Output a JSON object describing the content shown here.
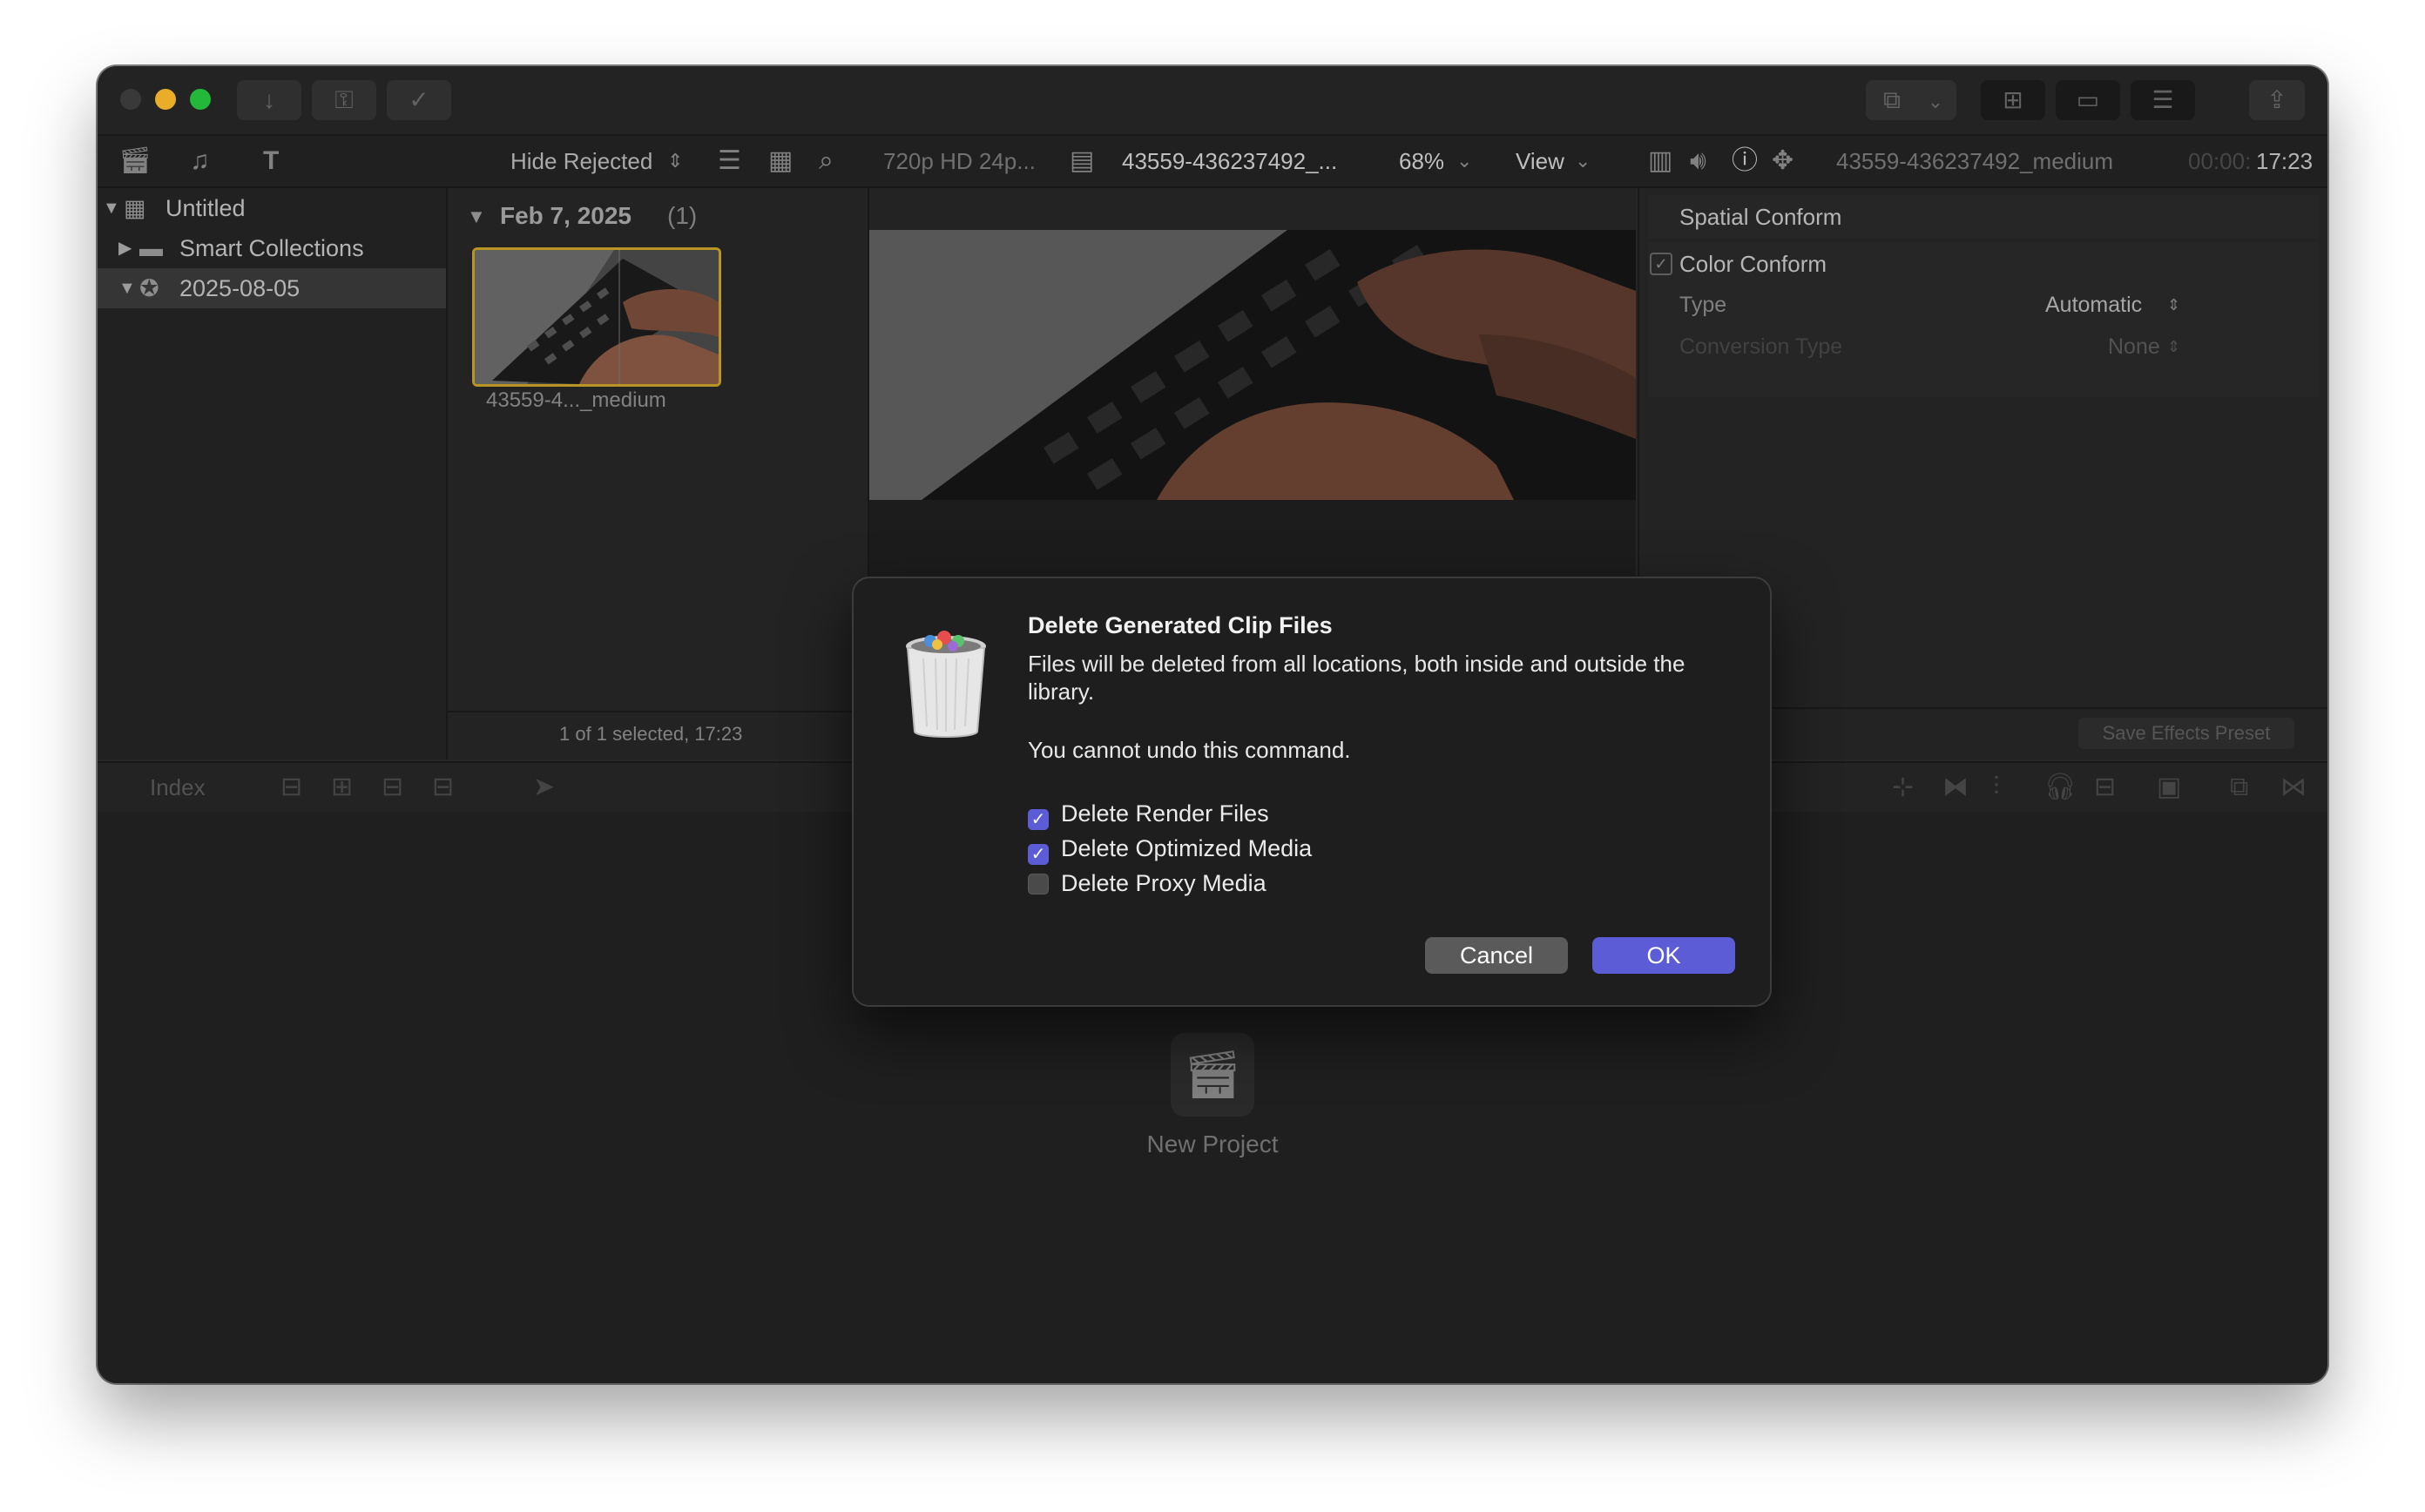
{
  "app": {
    "colors": {
      "accent": "#5b5cd6",
      "clip_selected": "#c9a227",
      "close": "#3e3e3e",
      "minimize": "#febc2e",
      "zoom": "#28c840"
    }
  },
  "browser_toolbar": {
    "filter": "Hide Rejected"
  },
  "viewer_toolbar": {
    "format": "720p HD 24p...",
    "clip_name": "43559-436237492_...",
    "zoom": "68%",
    "view_menu": "View"
  },
  "inspector_header": {
    "clip_name": "43559-436237492_medium",
    "timecode_dim": "00:00:",
    "timecode": "17:23"
  },
  "sidebar": {
    "library": "Untitled",
    "smart_collections": "Smart Collections",
    "event": "2025-08-05"
  },
  "browser": {
    "date_header": "Feb 7, 2025",
    "count": "(1)",
    "clip_label": "43559-4..._medium",
    "status": "1 of 1 selected, 17:23"
  },
  "inspector": {
    "spatial_conform": "Spatial Conform",
    "color_conform": "Color Conform",
    "type_label": "Type",
    "type_value": "Automatic",
    "conversion_label": "Conversion Type",
    "conversion_value": "None",
    "save_preset": "Save Effects Preset"
  },
  "timeline": {
    "index": "Index",
    "new_project": "New Project"
  },
  "dialog": {
    "title": "Delete Generated Clip Files",
    "message": "Files will be deleted from all locations, both inside and outside the library.",
    "warning": "You cannot undo this command.",
    "options": [
      {
        "label": "Delete Render Files",
        "checked": true
      },
      {
        "label": "Delete Optimized Media",
        "checked": true
      },
      {
        "label": "Delete Proxy Media",
        "checked": false
      }
    ],
    "cancel": "Cancel",
    "ok": "OK"
  }
}
